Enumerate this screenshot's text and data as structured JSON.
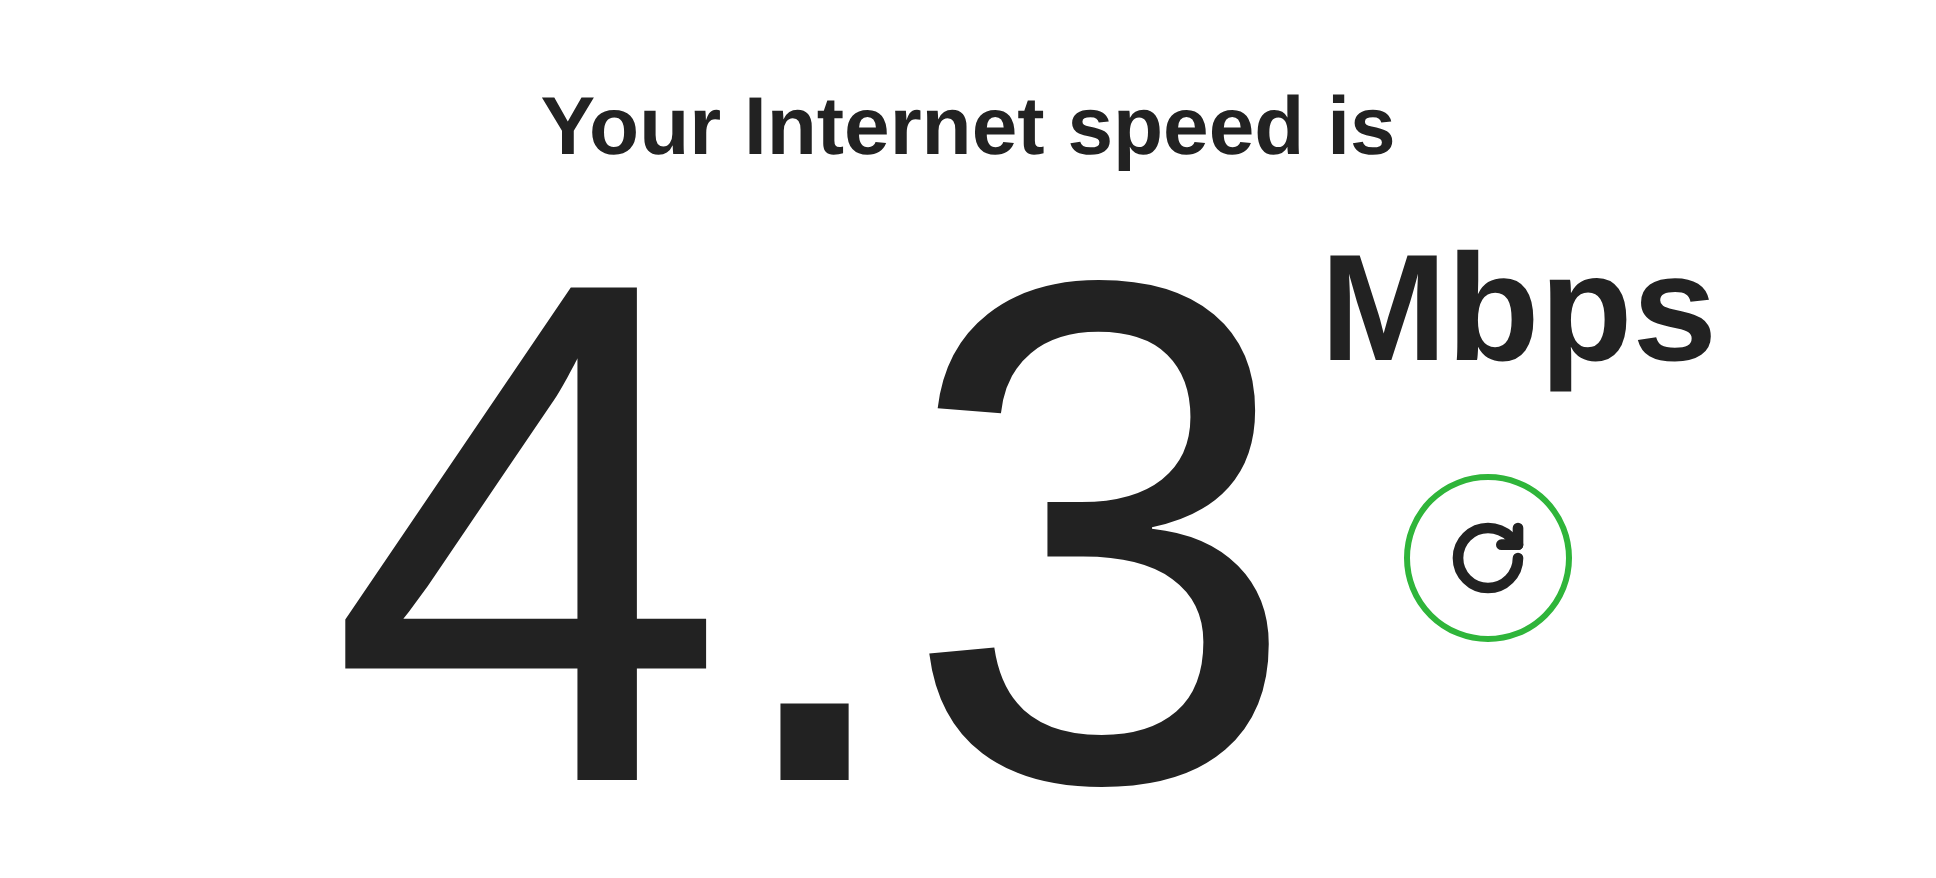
{
  "heading": "Your Internet speed is",
  "speed": {
    "value": "4.3",
    "units": "Mbps"
  }
}
